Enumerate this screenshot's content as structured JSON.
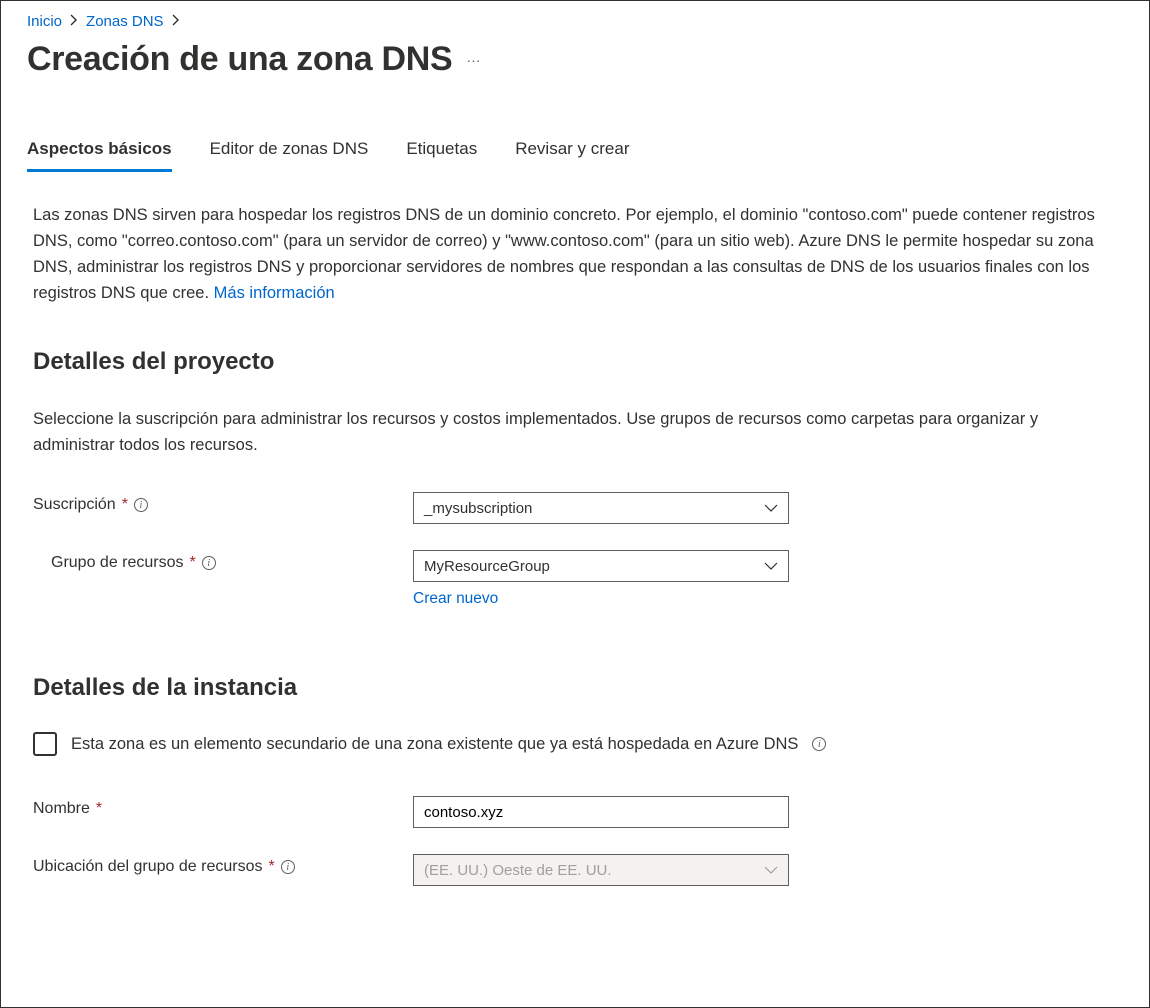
{
  "breadcrumb": {
    "home": "Inicio",
    "dns_zones": "Zonas DNS"
  },
  "page_title": "Creación de una zona DNS",
  "tabs": {
    "basics": "Aspectos básicos",
    "editor": "Editor de zonas DNS",
    "tags": "Etiquetas",
    "review": "Revisar y crear"
  },
  "intro_text": "Las zonas DNS sirven para hospedar los registros DNS de un dominio concreto. Por ejemplo, el dominio \"contoso.com\" puede contener registros DNS, como \"correo.contoso.com\" (para un servidor de correo) y \"www.contoso.com\" (para un sitio web). Azure DNS le permite hospedar su zona DNS, administrar los registros DNS y proporcionar servidores de nombres que respondan a las consultas de DNS de los usuarios finales con los registros DNS que cree. ",
  "more_info_link": "Más información",
  "project_details": {
    "heading": "Detalles del proyecto",
    "description": "Seleccione la suscripción para administrar los recursos y costos implementados. Use grupos de recursos como carpetas para organizar y administrar todos los recursos.",
    "subscription_label": "Suscripción",
    "subscription_value": "_mysubscription",
    "resource_group_label": "Grupo de recursos",
    "resource_group_value": "MyResourceGroup",
    "create_new": "Crear nuevo"
  },
  "instance_details": {
    "heading": "Detalles de la instancia",
    "child_zone_checkbox_label": "Esta zona es un elemento secundario de una zona existente que ya está hospedada en Azure DNS",
    "name_label": "Nombre",
    "name_value": "contoso.xyz",
    "location_label": "Ubicación del grupo de recursos",
    "location_value": "(EE. UU.) Oeste de EE. UU."
  }
}
